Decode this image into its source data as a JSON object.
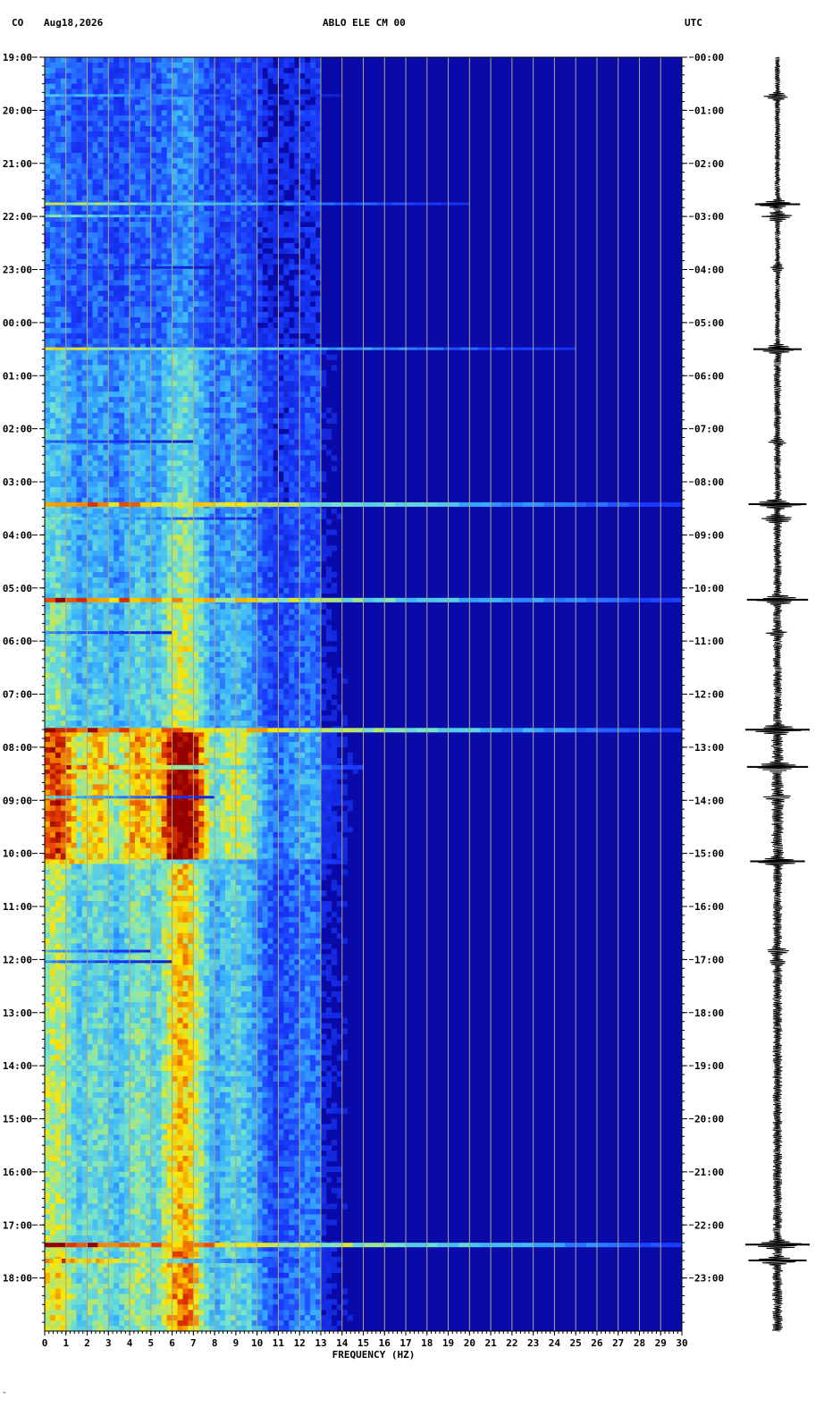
{
  "header": {
    "network": "CO",
    "date": "Aug18,2026",
    "station": "ABLO ELE CM 00",
    "timezone": "UTC"
  },
  "footer_mark": "-",
  "chart_data": {
    "type": "heatmap",
    "title": "ABLO ELE CM 00",
    "xlabel": "FREQUENCY (HZ)",
    "ylabel": "",
    "xlim": [
      0,
      30
    ],
    "x_ticks": [
      "0",
      "1",
      "2",
      "3",
      "4",
      "5",
      "6",
      "7",
      "8",
      "9",
      "10",
      "11",
      "12",
      "13",
      "14",
      "15",
      "16",
      "17",
      "18",
      "19",
      "20",
      "21",
      "22",
      "23",
      "24",
      "25",
      "26",
      "27",
      "28",
      "29",
      "30"
    ],
    "y_ticks_local": [
      "19:00",
      "20:00",
      "21:00",
      "22:00",
      "23:00",
      "00:00",
      "01:00",
      "02:00",
      "03:00",
      "04:00",
      "05:00",
      "06:00",
      "07:00",
      "08:00",
      "09:00",
      "10:00",
      "11:00",
      "12:00",
      "13:00",
      "14:00",
      "15:00",
      "16:00",
      "17:00",
      "18:00"
    ],
    "y_ticks_utc": [
      "00:00",
      "01:00",
      "02:00",
      "03:00",
      "04:00",
      "05:00",
      "06:00",
      "07:00",
      "08:00",
      "09:00",
      "10:00",
      "11:00",
      "12:00",
      "13:00",
      "14:00",
      "15:00",
      "16:00",
      "17:00",
      "18:00",
      "19:00",
      "20:00",
      "21:00",
      "22:00",
      "23:00"
    ],
    "hours_span": 24,
    "colors": {
      "background": "#0a0aa8",
      "low": "#1a3cff",
      "mid": "#3ab4ff",
      "high": "#ffe600",
      "peak": "#b00000",
      "grid": "#b0a878"
    },
    "band_profile": [
      {
        "freq": 0.5,
        "level": 0.45
      },
      {
        "freq": 2.5,
        "level": 0.35
      },
      {
        "freq": 4.5,
        "level": 0.4
      },
      {
        "freq": 6.5,
        "level": 0.6
      },
      {
        "freq": 9,
        "level": 0.35
      },
      {
        "freq": 12.5,
        "level": 0.2
      }
    ],
    "events": [
      {
        "hour": 0.73,
        "max_freq": 14,
        "intensity": 0.5
      },
      {
        "hour": 2.77,
        "max_freq": 20,
        "intensity": 0.7
      },
      {
        "hour": 3.0,
        "max_freq": 12,
        "intensity": 0.6
      },
      {
        "hour": 3.97,
        "max_freq": 8,
        "intensity": 0.3
      },
      {
        "hour": 5.5,
        "max_freq": 25,
        "intensity": 0.75
      },
      {
        "hour": 7.25,
        "max_freq": 7,
        "intensity": 0.35
      },
      {
        "hour": 8.42,
        "max_freq": 30,
        "intensity": 0.9
      },
      {
        "hour": 8.7,
        "max_freq": 10,
        "intensity": 0.6
      },
      {
        "hour": 10.22,
        "max_freq": 30,
        "intensity": 0.95
      },
      {
        "hour": 10.85,
        "max_freq": 6,
        "intensity": 0.4
      },
      {
        "hour": 12.67,
        "max_freq": 30,
        "intensity": 1.0
      },
      {
        "hour": 13.37,
        "max_freq": 15,
        "intensity": 0.95
      },
      {
        "hour": 13.95,
        "max_freq": 8,
        "intensity": 0.55
      },
      {
        "hour": 15.15,
        "max_freq": 14,
        "intensity": 0.85
      },
      {
        "hour": 16.85,
        "max_freq": 5,
        "intensity": 0.5
      },
      {
        "hour": 17.05,
        "max_freq": 6,
        "intensity": 0.4
      },
      {
        "hour": 22.37,
        "max_freq": 30,
        "intensity": 1.0
      },
      {
        "hour": 22.67,
        "max_freq": 12,
        "intensity": 0.9
      }
    ],
    "active_periods": [
      {
        "from": 5.5,
        "to": 8.4,
        "level": 0.35
      },
      {
        "from": 8.4,
        "to": 10.2,
        "level": 0.4
      },
      {
        "from": 10.2,
        "to": 12.67,
        "level": 0.45
      },
      {
        "from": 12.67,
        "to": 15.2,
        "level": 0.7
      },
      {
        "from": 15.2,
        "to": 22.37,
        "level": 0.5
      },
      {
        "from": 22.37,
        "to": 24,
        "level": 0.55
      }
    ]
  }
}
